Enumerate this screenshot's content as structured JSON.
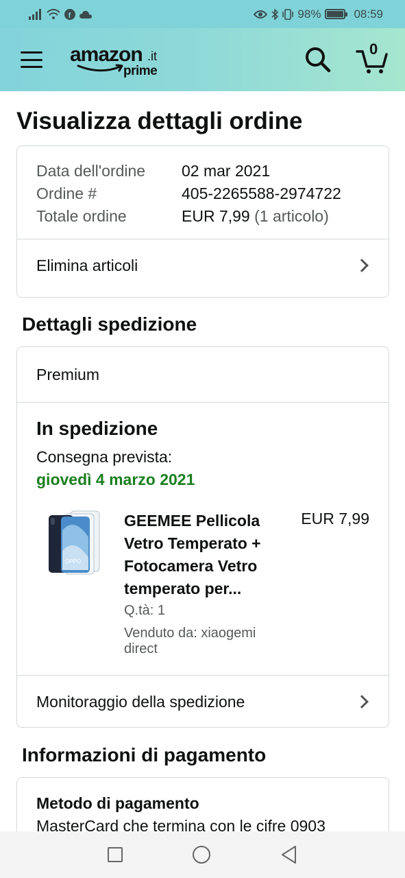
{
  "status_bar": {
    "battery": "98%",
    "battery_level": 0.98,
    "time": "08:59",
    "icons_left": [
      "signal-icon",
      "wifi-icon",
      "facebook-icon",
      "cloud-icon"
    ],
    "icons_right": [
      "eye-icon",
      "bluetooth-icon",
      "vibrate-icon",
      "battery-icon"
    ]
  },
  "header": {
    "logo_main": "amazon",
    "logo_tld": ".it",
    "logo_sub": "prime",
    "cart_count": "0"
  },
  "page": {
    "title": "Visualizza dettagli ordine"
  },
  "order_summary": {
    "rows": [
      {
        "label": "Data dell'ordine",
        "value": "02 mar 2021"
      },
      {
        "label": "Ordine #",
        "value": "405-2265588-2974722"
      },
      {
        "label": "Totale ordine",
        "value": "EUR 7,99",
        "extra": "(1 articolo)"
      }
    ],
    "remove_items_label": "Elimina articoli"
  },
  "shipping": {
    "section_title": "Dettagli spedizione",
    "type": "Premium",
    "status": "In spedizione",
    "expected_label": "Consegna prevista:",
    "expected_date": "giovedì 4 marzo 2021",
    "item": {
      "name": "GEEMEE Pellicola Vetro Temperato + Fotocamera Vetro temperato per...",
      "price": "EUR 7,99",
      "qty": "Q.tà: 1",
      "seller": "Venduto da: xiaogemi direct"
    },
    "tracking_label": "Monitoraggio della spedizione"
  },
  "payment": {
    "section_title": "Informazioni di pagamento",
    "method_label": "Metodo di pagamento",
    "method_value": "MasterCard che termina con le cifre 0903"
  },
  "colors": {
    "header_start": "#82d4da",
    "header_end": "#a6e6cf",
    "delivery_green": "#1a7f1e"
  }
}
